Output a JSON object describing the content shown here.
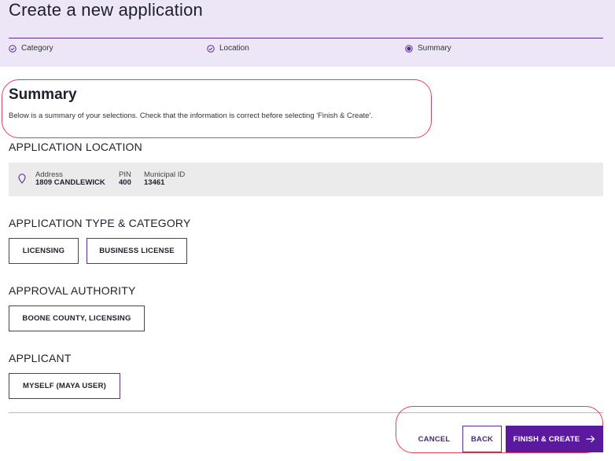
{
  "header": {
    "title": "Create a new application",
    "steps": [
      {
        "label": "Category",
        "state": "complete",
        "icon": "check-circle-icon"
      },
      {
        "label": "Location",
        "state": "complete",
        "icon": "check-circle-icon"
      },
      {
        "label": "Summary",
        "state": "current",
        "icon": "radio-filled-icon"
      }
    ]
  },
  "summary": {
    "heading": "Summary",
    "description": "Below is a summary of your selections. Check that the information is correct before selecting 'Finish & Create'."
  },
  "location": {
    "label": "APPLICATION LOCATION",
    "icon": "map-pin-icon",
    "address_key": "Address",
    "address_value": "1809 CANDLEWICK",
    "pin_key": "PIN",
    "pin_value": "400",
    "municipal_key": "Municipal ID",
    "municipal_value": "13461"
  },
  "type_category": {
    "label": "APPLICATION TYPE & CATEGORY",
    "type": "LICENSING",
    "category": "BUSINESS LICENSE"
  },
  "authority": {
    "label": "APPROVAL AUTHORITY",
    "value": "BOONE COUNTY, LICENSING"
  },
  "applicant": {
    "label": "APPLICANT",
    "value": "MYSELF (MAYA USER)"
  },
  "actions": {
    "cancel": "CANCEL",
    "back": "BACK",
    "finish": "FINISH & CREATE",
    "finish_icon": "arrow-right-icon"
  },
  "colors": {
    "accent": "#5b1a9e",
    "header_bg": "#ece6f6",
    "annotation": "#e0415a"
  }
}
